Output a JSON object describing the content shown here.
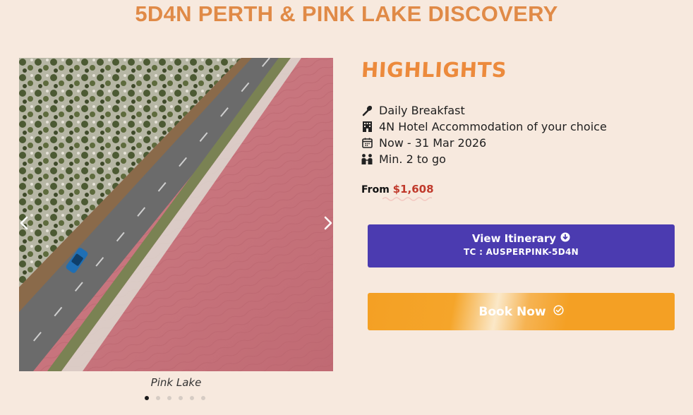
{
  "page": {
    "title": "5D4N PERTH & PINK LAKE DISCOVERY"
  },
  "gallery": {
    "image_description": "Aerial view of road beside pink lake",
    "caption": "Pink Lake",
    "dot_count": 6,
    "active_index": 0,
    "prev_icon": "chevron-left-icon",
    "next_icon": "chevron-right-icon"
  },
  "highlights": {
    "heading": "HIGHLIGHTS",
    "items": [
      {
        "icon": "utensil-icon",
        "label": "Daily Breakfast"
      },
      {
        "icon": "hotel-icon",
        "label": "4N Hotel Accommodation of your choice"
      },
      {
        "icon": "calendar-icon",
        "label": "Now - 31 Mar 2026"
      },
      {
        "icon": "people-icon",
        "label": "Min. 2 to go"
      }
    ]
  },
  "price": {
    "prefix": "From",
    "amount": "$1,608"
  },
  "itinerary_button": {
    "label": "View Itinerary",
    "code": "TC : AUSPERPINK-5D4N",
    "icon": "circle-down-arrow-icon"
  },
  "book_button": {
    "label": "Book Now",
    "icon": "circle-check-icon"
  },
  "colors": {
    "background": "#f7e9de",
    "title": "#e08a47",
    "highlights": "#ec8a3c",
    "price": "#c0392b",
    "itinerary_bg": "#4b3bb0",
    "book_bg": "#f4a024"
  }
}
